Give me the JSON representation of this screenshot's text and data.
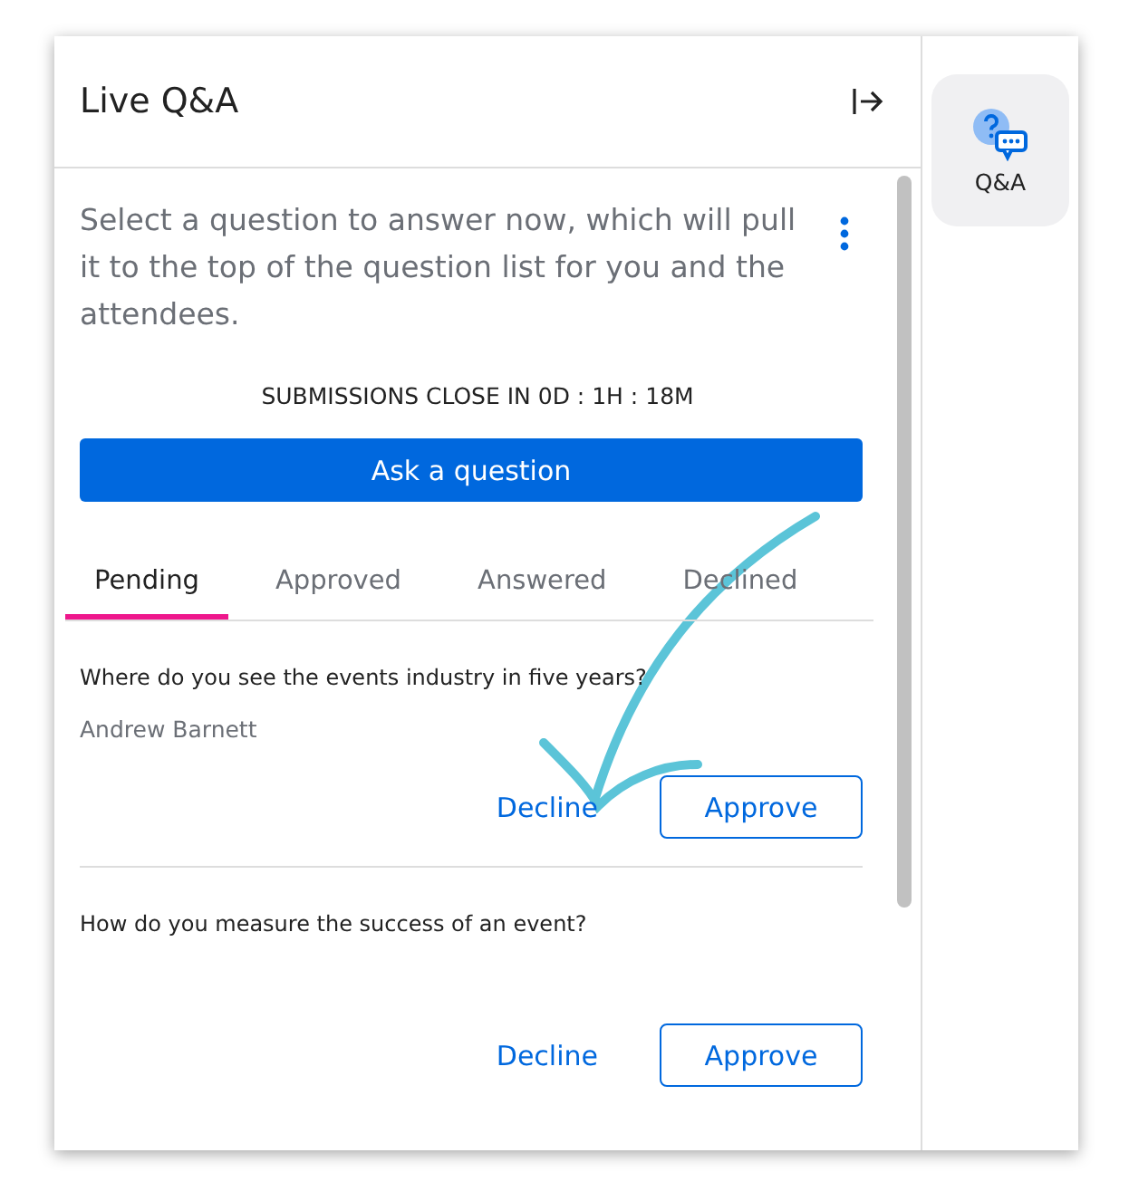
{
  "panel": {
    "title": "Live Q&A"
  },
  "intro": "Select a question to answer now, which will pull it to the top of the question list for you and the attendees.",
  "countdown": "SUBMISSIONS CLOSE IN 0D : 1H : 18M",
  "ask_button": "Ask a question",
  "tabs": [
    {
      "label": "Pending",
      "selected": true
    },
    {
      "label": "Approved",
      "selected": false
    },
    {
      "label": "Answered",
      "selected": false
    },
    {
      "label": "Declined",
      "selected": false
    }
  ],
  "questions": [
    {
      "text": "Where do you see the events industry in five years?",
      "author": "Andrew Barnett",
      "decline": "Decline",
      "approve": "Approve"
    },
    {
      "text": "How do you measure the success of an event?",
      "decline": "Decline",
      "approve": "Approve"
    }
  ],
  "sidebar": {
    "items": [
      {
        "label": "Q&A",
        "selected": true
      }
    ]
  }
}
